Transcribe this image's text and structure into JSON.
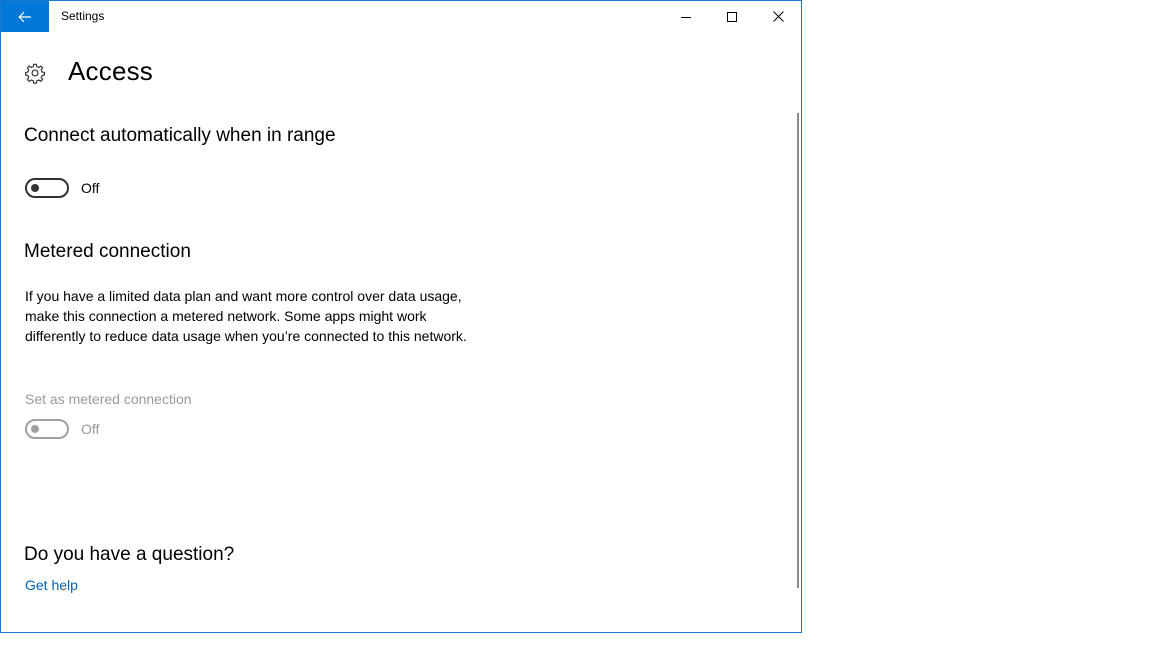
{
  "window": {
    "title": "Settings"
  },
  "page": {
    "title": "Access",
    "icon": "gear-icon"
  },
  "auto_connect": {
    "heading": "Connect automatically when in range",
    "toggle_state": "Off",
    "enabled": false
  },
  "metered": {
    "heading": "Metered connection",
    "description": "If you have a limited data plan and want more control over data usage, make this connection a metered network. Some apps might work differently to reduce data usage when you’re connected to this network.",
    "toggle_label": "Set as metered connection",
    "toggle_state": "Off",
    "toggle_disabled": true
  },
  "help": {
    "heading": "Do you have a question?",
    "link": "Get help"
  },
  "colors": {
    "accent": "#0078d7",
    "link": "#0063b1",
    "disabled_text": "#9a9a9a"
  }
}
